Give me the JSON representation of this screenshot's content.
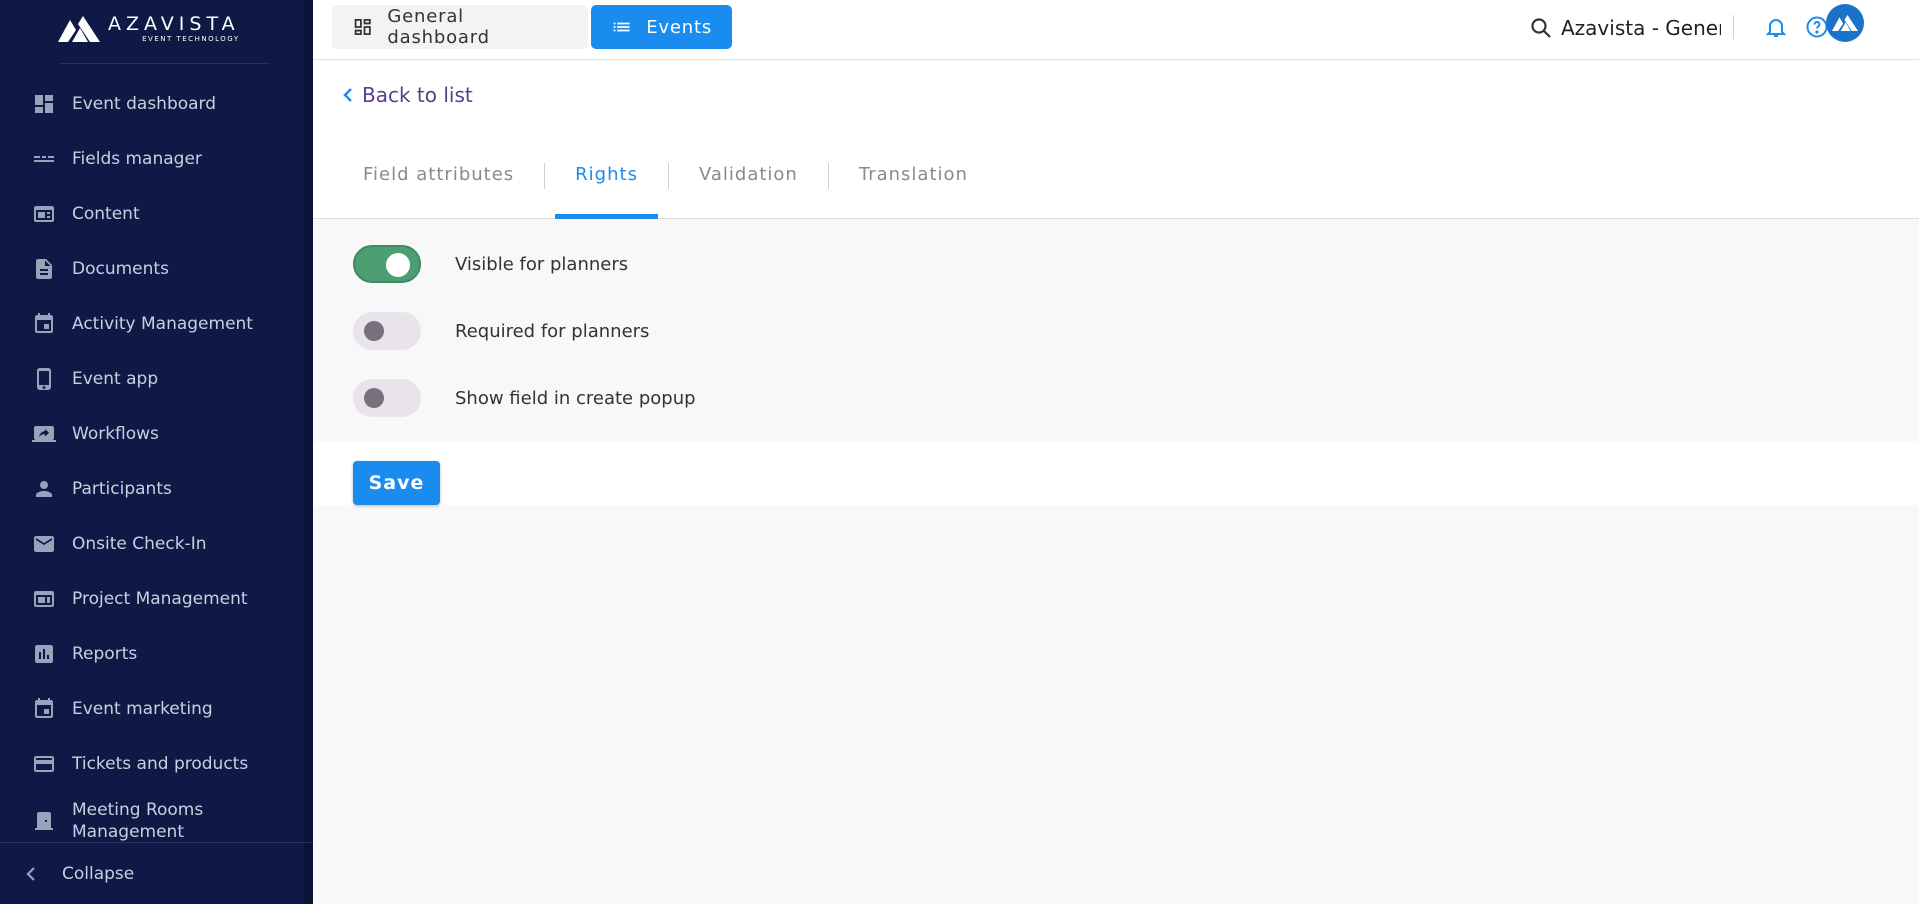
{
  "brand": {
    "name": "AZAVISTA",
    "tagline": "EVENT TECHNOLOGY"
  },
  "sidebar": {
    "items": [
      {
        "label": "Event dashboard",
        "icon": "dashboard-icon"
      },
      {
        "label": "Fields manager",
        "icon": "fields-icon"
      },
      {
        "label": "Content",
        "icon": "content-icon"
      },
      {
        "label": "Documents",
        "icon": "document-icon"
      },
      {
        "label": "Activity Management",
        "icon": "calendar-icon"
      },
      {
        "label": "Event app",
        "icon": "phone-icon"
      },
      {
        "label": "Workflows",
        "icon": "workflow-icon"
      },
      {
        "label": "Participants",
        "icon": "person-icon"
      },
      {
        "label": "Onsite Check-In",
        "icon": "mail-icon"
      },
      {
        "label": "Project Management",
        "icon": "project-icon"
      },
      {
        "label": "Reports",
        "icon": "chart-icon"
      },
      {
        "label": "Event marketing",
        "icon": "calendar-icon"
      },
      {
        "label": "Tickets and products",
        "icon": "card-icon"
      },
      {
        "label": "Meeting Rooms Management",
        "icon": "door-icon"
      }
    ],
    "collapse_label": "Collapse"
  },
  "topbar": {
    "general_label": "General dashboard",
    "events_label": "Events",
    "search_text": "Azavista - General",
    "accent": "#1a8cf0"
  },
  "page": {
    "back_label": "Back to list",
    "tabs": [
      {
        "label": "Field attributes",
        "active": false
      },
      {
        "label": "Rights",
        "active": true
      },
      {
        "label": "Validation",
        "active": false
      },
      {
        "label": "Translation",
        "active": false
      }
    ],
    "toggles": [
      {
        "label": "Visible for planners",
        "on": true
      },
      {
        "label": "Required for planners",
        "on": false
      },
      {
        "label": "Show field in create popup",
        "on": false
      }
    ],
    "save_label": "Save"
  }
}
